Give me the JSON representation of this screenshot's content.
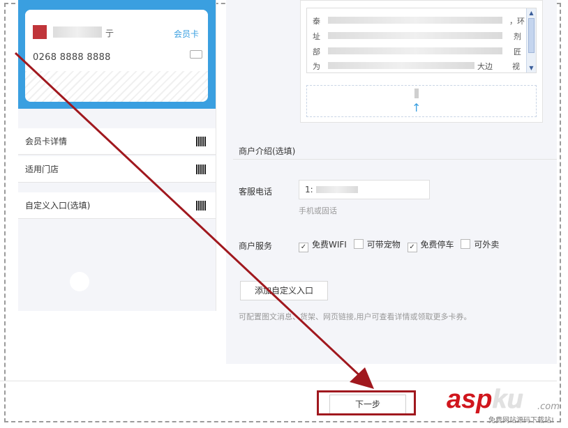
{
  "card": {
    "name_suffix": "亍",
    "type_label": "会员卡",
    "number": "0268 8888 8888",
    "brand_color": "#3a9fe0",
    "logo_color": "#c0353a"
  },
  "left_menu": {
    "items": [
      {
        "label": "会员卡详情"
      },
      {
        "label": "适用门店"
      },
      {
        "label": "自定义入口(选填)"
      }
    ]
  },
  "intro_text": {
    "lines": [
      "泰",
      "，环",
      "址",
      "剂",
      "部",
      "匠",
      "为",
      "大边",
      "视"
    ]
  },
  "merchant": {
    "section_title": "商户介绍(选填)",
    "phone_label": "客服电话",
    "phone_value": "1:",
    "phone_hint": "手机或固话",
    "services_label": "商户服务",
    "services": [
      {
        "label": "免费WIFI",
        "checked": true
      },
      {
        "label": "可带宠物",
        "checked": false
      },
      {
        "label": "免费停车",
        "checked": true
      },
      {
        "label": "可外卖",
        "checked": false
      }
    ],
    "add_entry_button": "添加自定义入口",
    "add_entry_hint": "可配置图文消息、货架、网页链接,用户可查看详情或领取更多卡券。"
  },
  "footer": {
    "next_button": "下一步"
  },
  "annotation": {
    "arrow_color": "#a0181e"
  },
  "watermark": {
    "brand_red": "asp",
    "brand_gray": "ku",
    "suffix": ".com",
    "tagline": "免费网站源码下载站!"
  }
}
